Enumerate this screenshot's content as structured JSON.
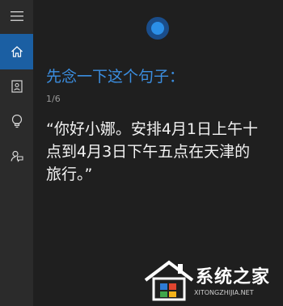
{
  "sidebar": {
    "items": [
      {
        "name": "menu",
        "active": false
      },
      {
        "name": "home",
        "active": true
      },
      {
        "name": "notebook",
        "active": false
      },
      {
        "name": "reminders",
        "active": false
      },
      {
        "name": "feedback",
        "active": false
      }
    ],
    "active_color": "#1b5fa3"
  },
  "main": {
    "prompt": "先念一下这个句子：",
    "counter": "1/6",
    "sentence": "“你好小娜。安排4月1日上午十点到4月3日下午五点在天津的旅行。”"
  },
  "watermark": {
    "title": "系统之家",
    "url": "XITONGZHIJIA.NET"
  },
  "colors": {
    "accent": "#3b8ee0",
    "background": "#1f1f1f",
    "sidebar": "#2b2b2b",
    "cortana_blue": "#2b8fe8"
  }
}
